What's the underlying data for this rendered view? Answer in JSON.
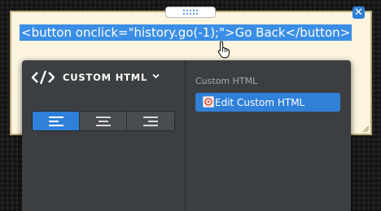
{
  "element": {
    "code": "<button onclick=\"history.go(-1);\">Go Back</button>",
    "close_icon": "close-icon",
    "drag_icon": "drag-handle-icon"
  },
  "panel": {
    "title": "CUSTOM HTML",
    "title_icon": "code-icon",
    "menu_icon": "chevron-down-icon",
    "alignment": {
      "options": [
        "align-left",
        "align-center",
        "align-right"
      ],
      "selected": "align-left"
    },
    "section_label": "Custom HTML",
    "edit_button": {
      "label": "Edit Custom HTML",
      "icon": "edit-html-icon"
    }
  },
  "colors": {
    "accent": "#2f80d8",
    "selection": "#3a8ee6",
    "panel_bg": "#3c3f41",
    "frame_bg": "#fdf5df"
  }
}
